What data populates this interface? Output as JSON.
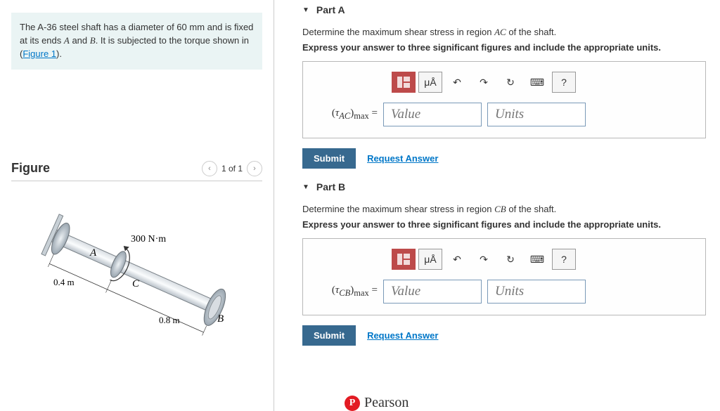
{
  "problem": {
    "text_before": "The A-36 steel shaft has a diameter of ",
    "diameter": "60 mm",
    "text_mid": " and is fixed at its ends ",
    "end_a": "A",
    "and": " and ",
    "end_b": "B",
    "text_after": ". It is subjected to the torque shown in (",
    "fig_link": "Figure 1",
    "close": ")."
  },
  "figure": {
    "title": "Figure",
    "pager": "1 of 1",
    "labels": {
      "A": "A",
      "B": "B",
      "C": "C",
      "torque": "300 N·m",
      "len1": "0.4 m",
      "len2": "0.8 m"
    }
  },
  "partA": {
    "title": "Part A",
    "prompt_pre": "Determine the maximum shear stress in region ",
    "region": "AC",
    "prompt_post": " of the shaft.",
    "instruction": "Express your answer to three significant figures and include the appropriate units.",
    "var_label_html": "(τ_AC)_max =",
    "value_ph": "Value",
    "units_ph": "Units",
    "submit": "Submit",
    "request": "Request Answer"
  },
  "partB": {
    "title": "Part B",
    "prompt_pre": "Determine the maximum shear stress in region ",
    "region": "CB",
    "prompt_post": " of the shaft.",
    "instruction": "Express your answer to three significant figures and include the appropriate units.",
    "var_label_html": "(τ_CB)_max =",
    "value_ph": "Value",
    "units_ph": "Units",
    "submit": "Submit",
    "request": "Request Answer"
  },
  "toolbar": {
    "units_btn": "μÅ",
    "help": "?"
  },
  "footer": {
    "brand": "Pearson",
    "logo": "P"
  }
}
